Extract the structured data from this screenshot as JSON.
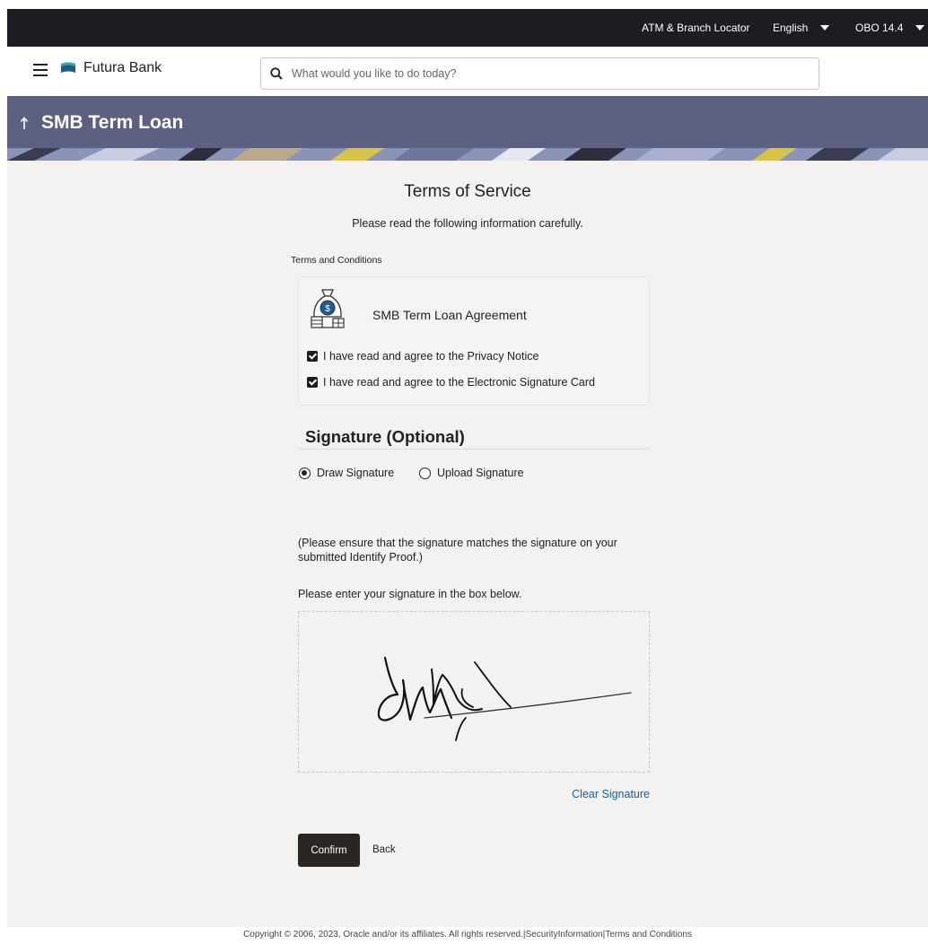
{
  "topbar": {
    "atm_locator": "ATM & Branch Locator",
    "language": "English",
    "version": "OBO 14.4"
  },
  "header": {
    "brand": "Futura Bank",
    "search_placeholder": "What would you like to do today?"
  },
  "banner": {
    "title": "SMB Term Loan"
  },
  "terms": {
    "title": "Terms of Service",
    "subtitle": "Please read the following information carefully.",
    "section_label": "Terms and Conditions",
    "card_title": "SMB Term Loan Agreement",
    "checkboxes": [
      {
        "label": "I have read and agree to the Privacy Notice",
        "checked": true
      },
      {
        "label": "I have read and agree to the Electronic Signature Card",
        "checked": true
      }
    ]
  },
  "signature": {
    "heading": "Signature (Optional)",
    "options": [
      {
        "label": "Draw Signature",
        "selected": true
      },
      {
        "label": "Upload Signature",
        "selected": false
      }
    ],
    "note": "(Please ensure that the signature matches the signature on your submitted Identify Proof.)",
    "instruction": "Please enter your signature in the box below.",
    "clear_label": "Clear Signature"
  },
  "actions": {
    "confirm_label": "Confirm",
    "back_label": "Back"
  },
  "footer": {
    "text": "Copyright © 2006, 2023, Oracle and/or its affiliates. All rights reserved.|SecurityInformation|Terms and Conditions"
  },
  "colors": {
    "topbar_bg": "#1c1d22",
    "banner_bg": "#5c6181",
    "page_bg": "#f3f2f0",
    "link": "#1d5d8e",
    "primary_button": "#2a2723"
  },
  "icons": [
    "hamburger-icon",
    "bank-logo-icon",
    "search-icon",
    "back-arrow-icon",
    "money-bag-icon",
    "caret-down-icon"
  ]
}
